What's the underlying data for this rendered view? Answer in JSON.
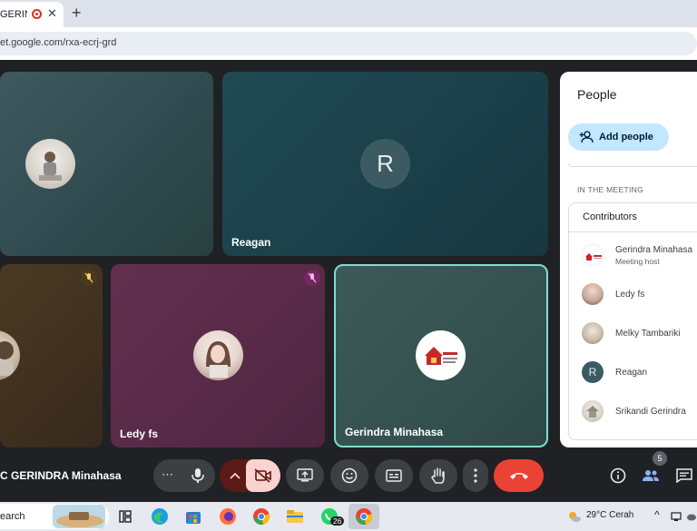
{
  "browser": {
    "tab_title": "GERINDR",
    "tab_close": "✕",
    "new_tab": "+",
    "url": "et.google.com/rxa-ecrj-grd"
  },
  "tiles": {
    "top_left": {
      "name": ""
    },
    "reagan": {
      "name": "Reagan",
      "initial": "R"
    },
    "bottom_left": {
      "name": ""
    },
    "ledy": {
      "name": "Ledy fs"
    },
    "gerindra": {
      "name": "Gerindra Minahasa"
    }
  },
  "people_panel": {
    "title": "People",
    "add_people": "Add people",
    "section": "IN THE MEETING",
    "group": "Contributors",
    "participants": [
      {
        "name": "Gerindra Minahasa",
        "role": "Meeting host"
      },
      {
        "name": "Ledy fs",
        "role": ""
      },
      {
        "name": "Melky Tambariki",
        "role": ""
      },
      {
        "name": "Reagan",
        "role": "",
        "initial": "R"
      },
      {
        "name": "Srikandi Gerindra",
        "role": ""
      }
    ]
  },
  "controls": {
    "meeting_name": "C GERINDRA Minahasa",
    "people_badge": "5",
    "more_dots": "⋯"
  },
  "taskbar": {
    "search": "earch",
    "whatsapp_badge": "26",
    "weather": "29°C  Cerah"
  },
  "colors": {
    "end_call": "#ea4335",
    "active_speaker_border": "#7fdcd2",
    "camera_off": "#fad2cf"
  }
}
